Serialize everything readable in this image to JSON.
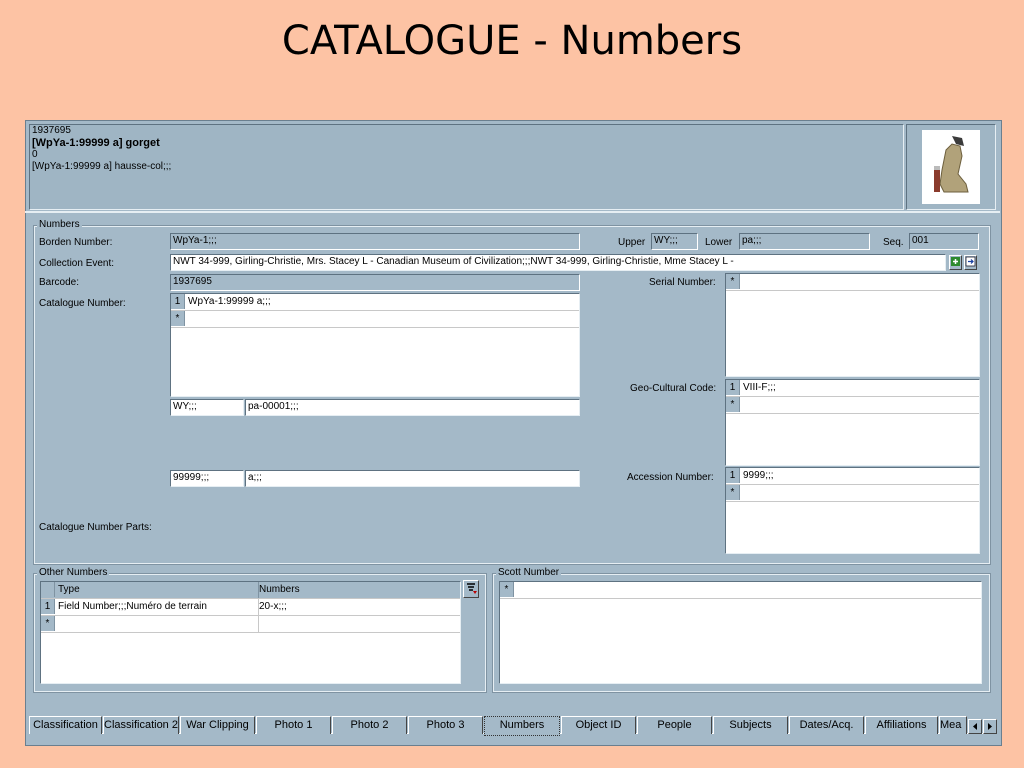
{
  "slide": {
    "title": "CATALOGUE - Numbers"
  },
  "header": {
    "line1": "1937695",
    "line2": "[WpYa-1:99999 a] gorget",
    "line3": "0",
    "line4": "[WpYa-1:99999 a] hausse-col;;;"
  },
  "numbers": {
    "group_label": "Numbers",
    "borden_label": "Borden Number:",
    "borden_value": "WpYa-1;;;",
    "upper_label": "Upper",
    "upper_value": "WY;;;",
    "lower_label": "Lower",
    "lower_value": "pa;;;",
    "seq_label": "Seq.",
    "seq_value": "001",
    "collection_label": "Collection Event:",
    "collection_value": "NWT 34-999, Girling-Christie, Mrs. Stacey L - Canadian Museum of Civilization;;;NWT 34-999, Girling-Christie, Mme Stacey L -",
    "barcode_label": "Barcode:",
    "barcode_value": "1937695",
    "catalogue_label": "Catalogue Number:",
    "catalogue_rows": [
      {
        "index": "1",
        "value": "WpYa-1:99999 a;;;"
      }
    ],
    "new_row_marker": "*",
    "cat_part1": "WY;;;",
    "cat_part2": "pa-00001;;;",
    "cat_part3": "99999;;;",
    "cat_part4": "a;;;",
    "catalogue_parts_label": "Catalogue Number Parts:",
    "serial_label": "Serial Number:",
    "geo_label": "Geo-Cultural Code:",
    "geo_rows": [
      {
        "index": "1",
        "value": "VIII-F;;;"
      }
    ],
    "accession_label": "Accession Number:",
    "accession_rows": [
      {
        "index": "1",
        "value": "9999;;;"
      }
    ]
  },
  "other_numbers": {
    "group_label": "Other Numbers",
    "col_type": "Type",
    "col_numbers": "Numbers",
    "rows": [
      {
        "index": "1",
        "type": "Field Number;;;Numéro de terrain",
        "numbers": "20-x;;;"
      }
    ]
  },
  "scott": {
    "group_label": "Scott Number"
  },
  "tabs": [
    "Classification",
    "Classification 2",
    "War Clipping",
    "Photo 1",
    "Photo 2",
    "Photo 3",
    "Numbers",
    "Object ID",
    "People",
    "Subjects",
    "Dates/Acq.",
    "Affiliations",
    "Mea"
  ],
  "active_tab": "Numbers",
  "colors": {
    "slide_bg": "#fdc3a4",
    "window_bg": "#a4b9c8"
  }
}
